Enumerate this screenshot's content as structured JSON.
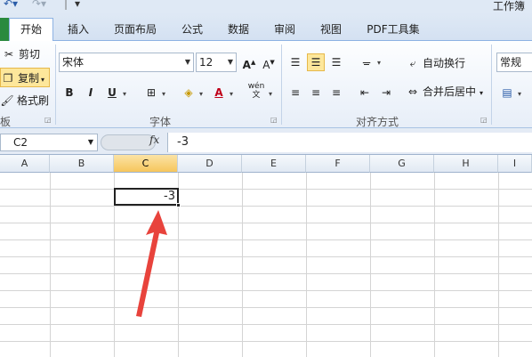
{
  "title": "工作簿",
  "tabs": [
    {
      "label": "开始",
      "active": true
    },
    {
      "label": "插入"
    },
    {
      "label": "页面布局"
    },
    {
      "label": "公式"
    },
    {
      "label": "数据"
    },
    {
      "label": "审阅"
    },
    {
      "label": "视图"
    },
    {
      "label": "PDF工具集"
    }
  ],
  "clipboard": {
    "cut": "剪切",
    "copy": "复制",
    "format_painter": "格式刷",
    "group_label": "板"
  },
  "font": {
    "name": "宋体",
    "size": "12",
    "bold": "B",
    "italic": "I",
    "underline": "U",
    "group_label": "字体"
  },
  "alignment": {
    "wrap_text": "自动换行",
    "merge_center": "合并后居中",
    "group_label": "对齐方式"
  },
  "number": {
    "format": "常规"
  },
  "formula_bar": {
    "name_box": "C2",
    "fx": "fx",
    "formula": "-3"
  },
  "grid": {
    "columns": [
      "A",
      "B",
      "C",
      "D",
      "E",
      "F",
      "G",
      "H",
      "I"
    ],
    "active_column": "C",
    "active_cell_value": "-3"
  },
  "colors": {
    "ribbon_accent": "#fde79b",
    "arrow": "#e8433c",
    "file_tab": "#2a8a3e"
  }
}
